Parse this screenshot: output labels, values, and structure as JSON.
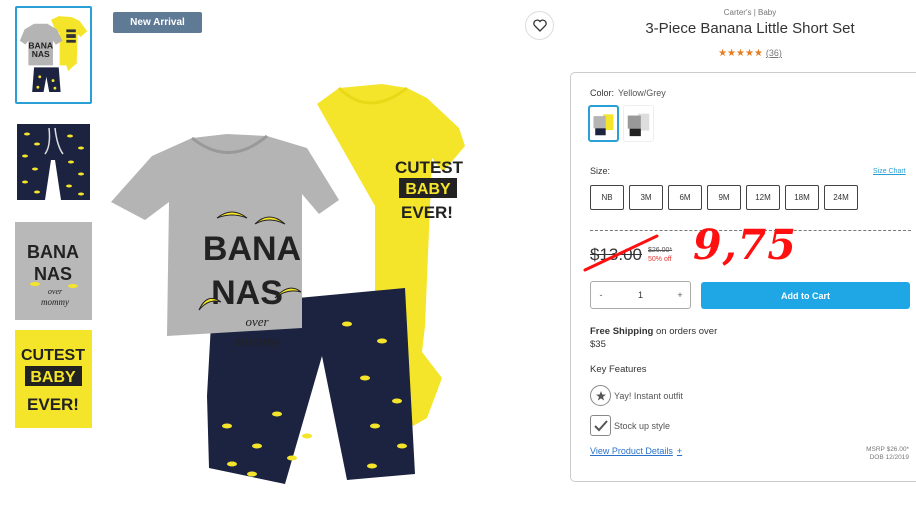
{
  "product": {
    "brand": "Carter's | Baby",
    "title": "3-Piece Banana Little Short Set",
    "stars": "★★★★★",
    "review_count": "(36)",
    "badge": "New Arrival"
  },
  "color": {
    "label": "Color:",
    "value": "Yellow/Grey",
    "swatches": [
      "yellow-grey",
      "grey-black"
    ]
  },
  "size": {
    "label": "Size:",
    "chart_link": "Size Chart",
    "options": [
      "NB",
      "3M",
      "6M",
      "9M",
      "12M",
      "18M",
      "24M"
    ]
  },
  "price": {
    "current": "$13.00",
    "msrp": "$26.00*",
    "discount": "50% off",
    "handwritten_price": "9,75"
  },
  "quantity": {
    "minus": "-",
    "value": "1",
    "plus": "+"
  },
  "cart": {
    "button_label": "Add to Cart"
  },
  "shipping": {
    "bold": "Free Shipping",
    "text": "on orders over",
    "threshold": "$35"
  },
  "features": {
    "title": "Key Features",
    "items": [
      "Yay! Instant outfit",
      "Stock up style"
    ]
  },
  "details": {
    "link": "View Product Details",
    "plus": "+"
  },
  "msrp_note": {
    "line1": "MSRP $26.00*",
    "line2": "DOB 12/2019"
  },
  "print": {
    "bananas_1": "BANA",
    "bananas_2": "NAS",
    "over": "over",
    "mommy": "mommy",
    "cutest": "CUTEST",
    "baby": "BABY",
    "ever": "EVER!"
  },
  "colors": {
    "accent": "#1ea7e4",
    "badge_bg": "#5f7a95",
    "handwritten_red": "#ff0f0f",
    "star": "#e67c1e",
    "yellow": "#f5e52a",
    "grey": "#a8a8a8",
    "navy": "#1c2340"
  }
}
